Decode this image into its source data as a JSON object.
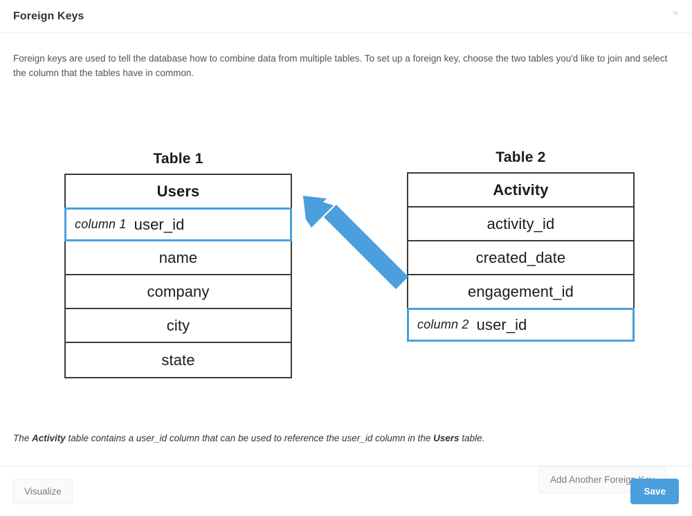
{
  "modal": {
    "title": "Foreign Keys",
    "close_icon": "close-icon",
    "close_glyph": "×",
    "intro": "Foreign keys are used to tell the database how to combine data from multiple tables. To set up a foreign key, choose the two tables you'd like to join and select the column that the tables have in common."
  },
  "diagram": {
    "table1": {
      "caption": "Table 1",
      "name": "Users",
      "rows": [
        {
          "label": "user_id",
          "column_label": "column 1",
          "highlighted": true
        },
        {
          "label": "name",
          "column_label": "",
          "highlighted": false
        },
        {
          "label": "company",
          "column_label": "",
          "highlighted": false
        },
        {
          "label": "city",
          "column_label": "",
          "highlighted": false
        },
        {
          "label": "state",
          "column_label": "",
          "highlighted": false
        }
      ]
    },
    "table2": {
      "caption": "Table 2",
      "name": "Activity",
      "rows": [
        {
          "label": "activity_id",
          "column_label": "",
          "highlighted": false
        },
        {
          "label": "created_date",
          "column_label": "",
          "highlighted": false
        },
        {
          "label": "engagement_id",
          "column_label": "",
          "highlighted": false
        },
        {
          "label": "user_id",
          "column_label": "column 2",
          "highlighted": true
        }
      ]
    },
    "arrow": {
      "name": "relationship-arrow",
      "color": "#4a9fdc",
      "direction": "from-table2-user_id-to-table1-user_id"
    }
  },
  "note": {
    "prefix": "The ",
    "bold1": "Activity",
    "middle": " table contains a user_id column that can be used to reference the user_id column in the ",
    "bold2": "Users",
    "suffix": " table."
  },
  "actions": {
    "add_another": "Add Another Foreign Key",
    "visualize": "Visualize",
    "save": "Save"
  },
  "colors": {
    "accent": "#4a9fdc",
    "table_border": "#3a3a3a",
    "text": "#2e353b",
    "muted": "#747e85"
  }
}
